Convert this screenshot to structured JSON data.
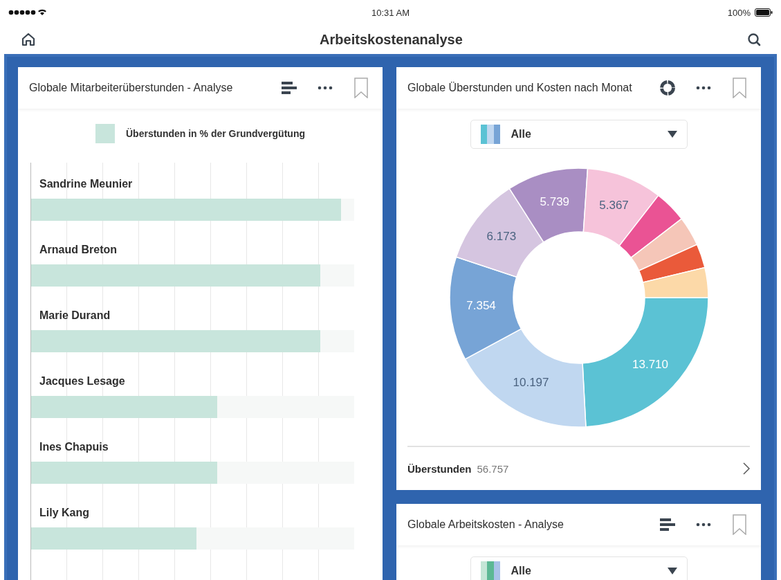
{
  "status_bar": {
    "time": "10:31 AM",
    "battery": "100%"
  },
  "nav": {
    "title": "Arbeitskostenanalyse"
  },
  "overtime_card": {
    "title": "Globale Mitarbeiterüberstunden - Analyse",
    "legend": "Überstunden in % der Grundvergütung",
    "rows": [
      {
        "name": "Sandrine Meunier",
        "level": 0.96
      },
      {
        "name": "Arnaud Breton",
        "level": 0.895
      },
      {
        "name": "Marie Durand",
        "level": 0.895
      },
      {
        "name": "Jacques Lesage",
        "level": 0.576
      },
      {
        "name": "Ines Chapuis",
        "level": 0.576
      },
      {
        "name": "Lily Kang",
        "level": 0.512
      }
    ]
  },
  "monthly_card": {
    "title": "Globale Überstunden und Kosten nach Monat",
    "filter": "Alle",
    "chart_data": {
      "type": "donut",
      "values": [
        13710,
        10197,
        7354,
        6173,
        5739,
        5367,
        2300,
        2100,
        1700,
        2117
      ],
      "colors": [
        "#5bc2d4",
        "#c0d7f0",
        "#77a4d6",
        "#d5c5e0",
        "#a98ec3",
        "#f6c3da",
        "#ea5394",
        "#f5c6b8",
        "#ea5a3a",
        "#fcd9a8"
      ],
      "value_labels": [
        "13.710",
        "10.197",
        "7.354",
        "6.173",
        "5.739",
        "5.367",
        null,
        null,
        null,
        null
      ]
    },
    "footer_label": "Überstunden",
    "footer_value": "56.757"
  },
  "cost_card": {
    "title": "Globale Arbeitskosten - Analyse",
    "filter": "Alle"
  }
}
